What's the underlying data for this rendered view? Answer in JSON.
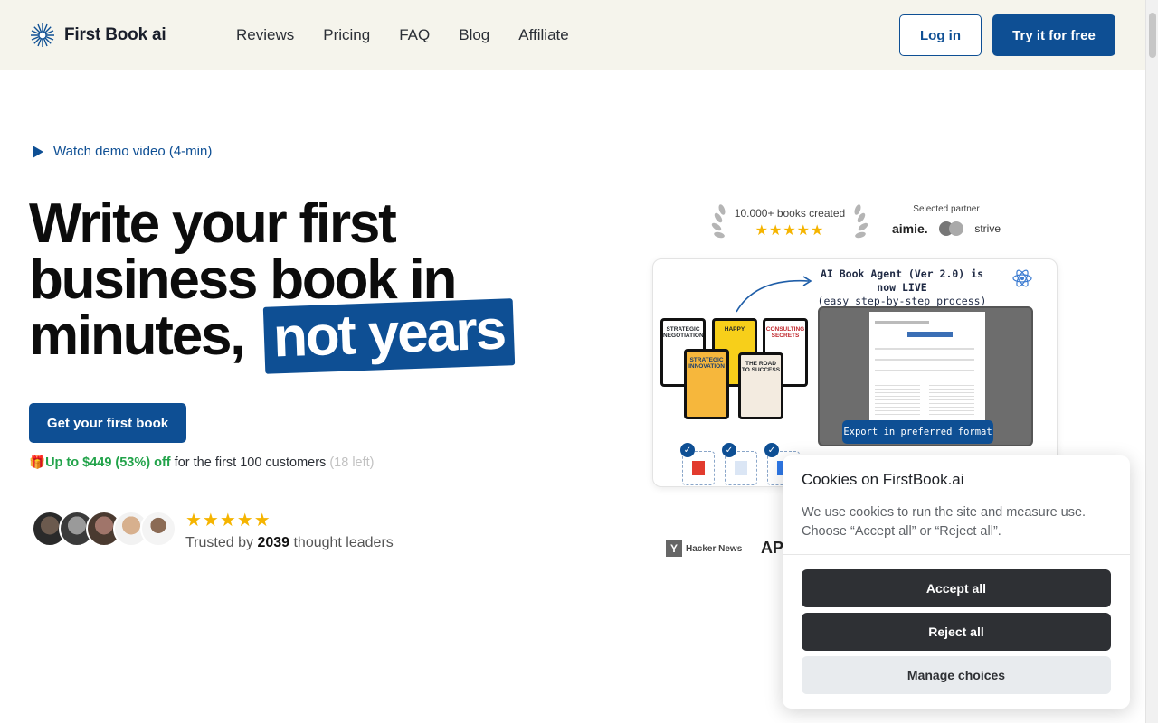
{
  "header": {
    "logo_text": "First Book ai",
    "nav": [
      "Reviews",
      "Pricing",
      "FAQ",
      "Blog",
      "Affiliate"
    ],
    "login_label": "Log in",
    "try_label": "Try it for free"
  },
  "hero": {
    "demo_link": "Watch demo video (4-min)",
    "headline_line1": "Write your first",
    "headline_line2": "business book in",
    "headline_line3": "minutes,",
    "headline_highlight": "not years",
    "cta_label": "Get your first book",
    "offer_gift": "🎁",
    "offer_highlight": "Up to $449 (53%) off",
    "offer_text": " for the first 100 customers ",
    "offer_left": "(18 left)",
    "stars": "★★★★★",
    "trust_prefix": "Trusted by ",
    "trust_count": "2039",
    "trust_suffix": " thought leaders"
  },
  "badges": {
    "books_created": "10.000+ books created",
    "stars": "★★★★★",
    "partner_label": "Selected partner",
    "partner_1": "aimie.",
    "partner_3": "strive"
  },
  "demo_card": {
    "title": "AI Book Agent (Ver 2.0) is now LIVE",
    "subtitle": "(easy step-by-step process)",
    "export_label": "Export in preferred format",
    "books": [
      {
        "title": "STRATEGIC NEGOTIATION"
      },
      {
        "title": "HAPPY"
      },
      {
        "title": "CONSULTING SECRETS"
      },
      {
        "title": "STRATEGIC INNOVATION"
      },
      {
        "title": "THE ROAD TO SUCCESS"
      }
    ]
  },
  "press": {
    "hn_mark": "Y",
    "hn_label": "Hacker News",
    "ap_label": "AP"
  },
  "cookie": {
    "title": "Cookies on FirstBook.ai",
    "body": "We use cookies to run the site and measure use. Choose “Accept all” or “Reject all”.",
    "accept": "Accept all",
    "reject": "Reject all",
    "manage": "Manage choices"
  },
  "colors": {
    "brand": "#0e4f94",
    "accent_green": "#22a34a",
    "star": "#f5b400"
  }
}
